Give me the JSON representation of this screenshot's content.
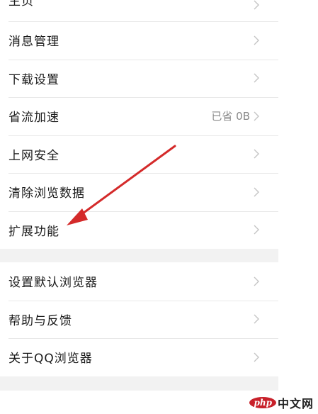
{
  "group1": [
    {
      "label": "主页"
    },
    {
      "label": "消息管理"
    },
    {
      "label": "下载设置"
    },
    {
      "label": "省流加速",
      "value": "已省 0B"
    },
    {
      "label": "上网安全"
    },
    {
      "label": "清除浏览数据"
    },
    {
      "label": "扩展功能"
    }
  ],
  "group2": [
    {
      "label": "设置默认浏览器"
    },
    {
      "label": "帮助与反馈"
    },
    {
      "label": "关于QQ浏览器"
    }
  ],
  "annotation": {
    "color": "#d42a2a",
    "points_to": "扩展功能"
  },
  "watermark": {
    "logo": "php",
    "text": "中文网"
  },
  "colors": {
    "row_bg": "#ffffff",
    "gap_bg": "#f2f2f2",
    "text": "#1a1a1a",
    "muted": "#888888",
    "chevron": "#c4c4c4"
  },
  "icons": [
    "chevron-right-icon"
  ]
}
